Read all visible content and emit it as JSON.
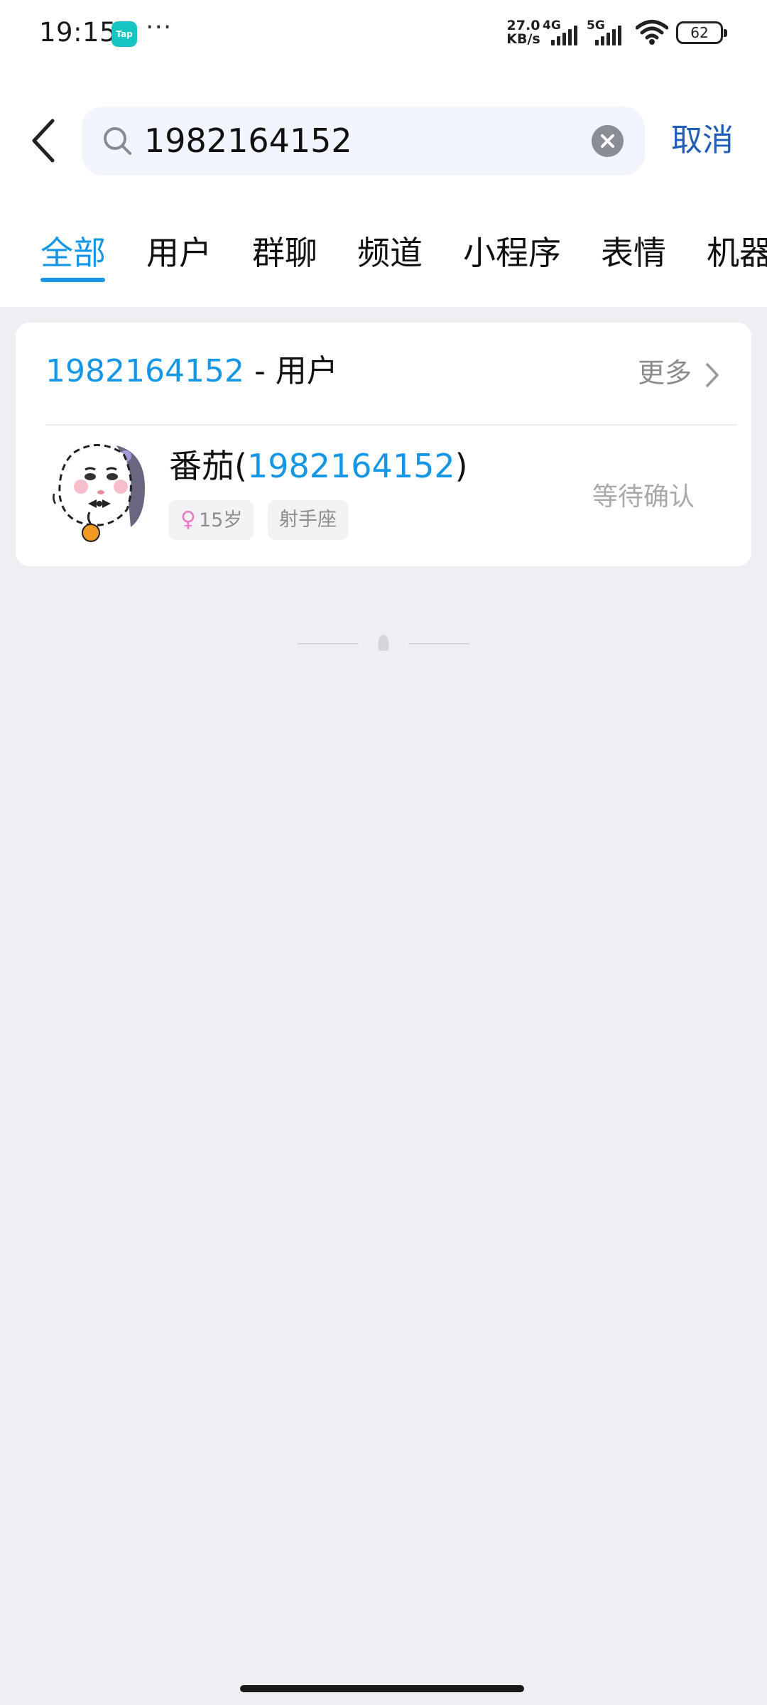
{
  "status_bar": {
    "time": "19:15",
    "app_badge": "Tap",
    "more_dots": "···",
    "net_speed_value": "27.0",
    "net_speed_unit": "KB/s",
    "sim1_label": "4G",
    "sim2_label": "5G",
    "battery": "62"
  },
  "search": {
    "query": "1982164152",
    "cancel_label": "取消"
  },
  "tabs": [
    "全部",
    "用户",
    "群聊",
    "频道",
    "小程序",
    "表情",
    "机器"
  ],
  "active_tab": "全部",
  "result_section": {
    "query": "1982164152",
    "suffix": " - 用户",
    "more_label": "更多",
    "user": {
      "name_prefix": "番茄(",
      "id": "1982164152",
      "name_suffix": ")",
      "age_tag": "15岁",
      "gender": "female",
      "zodiac_tag": "射手座",
      "status": "等待确认"
    }
  },
  "colors": {
    "accent": "#1597e5",
    "cancel": "#1f5fb8",
    "background": "#eeeff2"
  }
}
